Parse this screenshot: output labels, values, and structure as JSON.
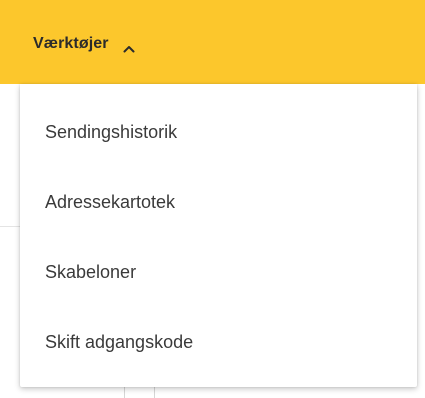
{
  "header": {
    "menu_label": "Værktøjer",
    "menu_icon": "chevron-up-icon",
    "accent_color": "#fcc72c"
  },
  "dropdown": {
    "items": [
      {
        "label": "Sendingshistorik"
      },
      {
        "label": "Adressekartotek"
      },
      {
        "label": "Skabeloner"
      },
      {
        "label": "Skift adgangskode"
      }
    ]
  }
}
